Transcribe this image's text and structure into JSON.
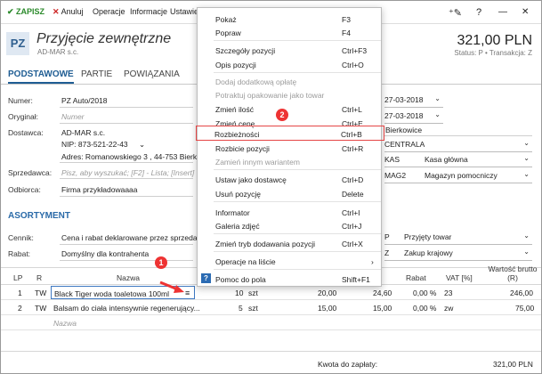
{
  "toolbar": {
    "zapisz": "ZAPISZ",
    "anuluj": "Anuluj",
    "operacje": "Operacje",
    "informacje": "Informacje",
    "ustawienia": "Ustawie"
  },
  "header": {
    "code": "PZ",
    "title": "Przyjęcie zewnętrzne",
    "contractor": "AD-MAR s.c.",
    "amount": "321,00 PLN",
    "status": "Status: P  •  Transakcja: Z"
  },
  "tabs": [
    "PODSTAWOWE",
    "PARTIE",
    "POWIĄZANIA"
  ],
  "form": {
    "numer_label": "Numer:",
    "numer": "PZ Auto/2018",
    "oryginal_label": "Oryginał:",
    "oryginal_placeholder": "Numer",
    "dostawca_label": "Dostawca:",
    "dostawca": "AD-MAR s.c.",
    "nip": "NIP:  873-521-22-43",
    "adres": "Adres:  Romanowskiego 3 , 44-753 Bierko",
    "sprzedawca_label": "Sprzedawca:",
    "sprzedawca_placeholder": "Pisz, aby wyszukać; [F2] - Lista; [Insert] - Dodaj",
    "odbiorca_label": "Odbiorca:",
    "odbiorca": "Firma przykładowaaaa",
    "date1": "27-03-2018",
    "date2": "27-03-2018",
    "city": "Bierkowice",
    "centrala": "CENTRALA",
    "kas_code": "KAS",
    "kas_name": "Kasa główna",
    "mag_code": "MAG2",
    "mag_name": "Magazyn pomocniczy"
  },
  "assortment": {
    "section": "ASORTYMENT",
    "cennik_label": "Cennik:",
    "cennik": "Cena i rabat deklarowane przez sprzedawc",
    "rabat_label": "Rabat:",
    "rabat": "Domyślny dla kontrahenta",
    "p_code": "P",
    "p_name": "Przyjęty towar",
    "z_code": "Z",
    "z_name": "Zakup krajowy"
  },
  "table": {
    "headers": [
      "LP",
      "R",
      "Nazwa",
      "Rabat",
      "VAT [%]",
      "Wartość brutto (R)"
    ],
    "rows": [
      {
        "lp": "1",
        "r": "TW",
        "name": "Black Tiger woda toaletowa 100ml",
        "qty": "10",
        "unit": "szt",
        "price1": "20,00",
        "price2": "24,60",
        "rabat": "0,00 %",
        "vat": "23",
        "value": "246,00"
      },
      {
        "lp": "2",
        "r": "TW",
        "name": "Balsam do ciała intensywnie regenerujący...",
        "qty": "5",
        "unit": "szt",
        "price1": "15,00",
        "price2": "15,00",
        "rabat": "0,00 %",
        "vat": "zw",
        "value": "75,00"
      }
    ],
    "new_row_placeholder": "Nazwa"
  },
  "footer": {
    "label": "Kwota do zapłaty:",
    "value": "321,00 PLN"
  },
  "menu": [
    {
      "label": "Pokaż",
      "key": "F3"
    },
    {
      "label": "Popraw",
      "key": "F4"
    },
    {
      "label": "Szczegóły pozycji",
      "key": "Ctrl+F3"
    },
    {
      "label": "Opis pozycji",
      "key": "Ctrl+O"
    },
    {
      "label": "Dodaj dodatkową opłatę",
      "key": ""
    },
    {
      "label": "Potraktuj opakowanie jako towar",
      "key": ""
    },
    {
      "label": "Zmień ilość",
      "key": "Ctrl+L"
    },
    {
      "label": "Zmień cenę",
      "key": "Ctrl+E"
    },
    {
      "label": "Rozbieżności",
      "key": "Ctrl+B"
    },
    {
      "label": "Rozbicie pozycji",
      "key": "Ctrl+R"
    },
    {
      "label": "Zamień innym wariantem",
      "key": ""
    },
    {
      "label": "Ustaw jako dostawcę",
      "key": "Ctrl+D"
    },
    {
      "label": "Usuń pozycję",
      "key": "Delete"
    },
    {
      "label": "Informator",
      "key": "Ctrl+I"
    },
    {
      "label": "Galeria zdjęć",
      "key": "Ctrl+J"
    },
    {
      "label": "Zmień tryb dodawania pozycji",
      "key": "Ctrl+X"
    },
    {
      "label": "Operacje na liście",
      "key": "›"
    },
    {
      "label": "Pomoc do pola",
      "key": "Shift+F1"
    }
  ],
  "annotations": [
    "1",
    "2"
  ]
}
